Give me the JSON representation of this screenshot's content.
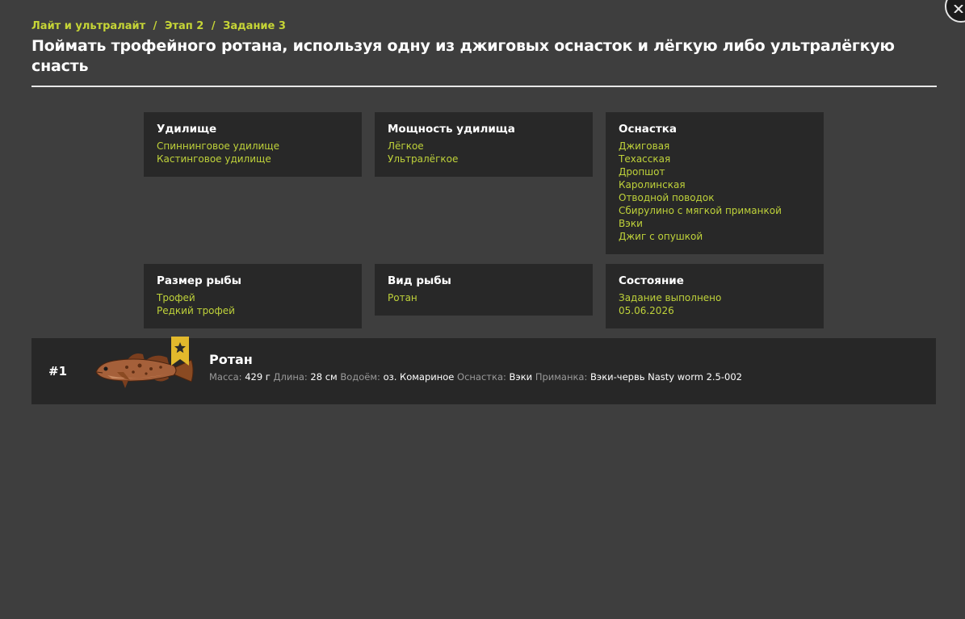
{
  "breadcrumb": {
    "items": [
      "Лайт и ультралайт",
      "Этап 2",
      "Задание 3"
    ],
    "separator": "/"
  },
  "title": "Поймать трофейного ротана, используя одну из джиговых оснасток и лёгкую либо ультралёгкую снасть",
  "colors": {
    "accent": "#c6d536",
    "background": "#3e3e3e",
    "card": "#282828"
  },
  "cards": {
    "rod": {
      "title": "Удилище",
      "items": [
        "Спиннинговое удилище",
        "Кастинговое удилище"
      ]
    },
    "power": {
      "title": "Мощность удилища",
      "items": [
        "Лёгкое",
        "Ультралёгкое"
      ]
    },
    "rig": {
      "title": "Оснастка",
      "items": [
        "Джиговая",
        "Техасская",
        "Дропшот",
        "Каролинская",
        "Отводной поводок",
        "Сбирулино с мягкой приманкой",
        "Вэки",
        "Джиг с опушкой"
      ]
    },
    "size": {
      "title": "Размер рыбы",
      "items": [
        "Трофей",
        "Редкий трофей"
      ]
    },
    "species": {
      "title": "Вид рыбы",
      "items": [
        "Ротан"
      ]
    },
    "status": {
      "title": "Состояние",
      "items": [
        "Задание выполнено",
        "05.06.2026"
      ]
    }
  },
  "result": {
    "rank": "#1",
    "fish_name": "Ротан",
    "mass_label": "Масса:",
    "mass_value": "429 г",
    "length_label": "Длина:",
    "length_value": "28 см",
    "water_label": "Водоём:",
    "water_value": "оз. Комариное",
    "rig_label": "Оснастка:",
    "rig_value": "Вэки",
    "bait_label": "Приманка:",
    "bait_value": "Вэки-червь Nasty worm 2.5-002",
    "badge_icon": "trophy-star-icon",
    "fish_icon": "rotan-fish-image"
  },
  "close_icon": "close-icon"
}
